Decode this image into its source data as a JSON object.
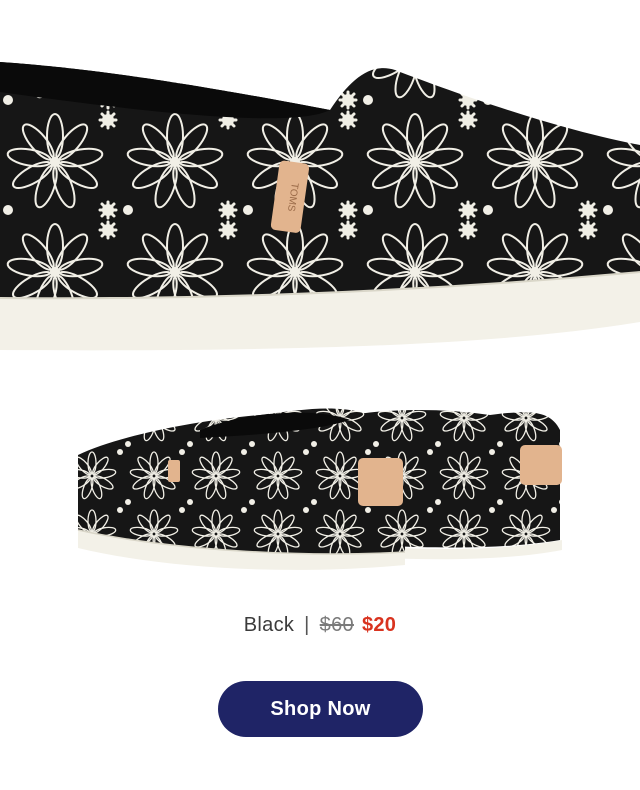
{
  "product": {
    "color_name": "Black",
    "separator": "|",
    "original_price": "$60",
    "sale_price": "$20",
    "brand_tag_text": "TOMS"
  },
  "cta": {
    "label": "Shop Now"
  },
  "colors": {
    "button_bg": "#1f2466",
    "sale_price": "#d9331f",
    "shoe_body": "#141414",
    "embroidery": "#f1efe6",
    "sole": "#f3f1e8",
    "tag": "#e2b48e"
  }
}
